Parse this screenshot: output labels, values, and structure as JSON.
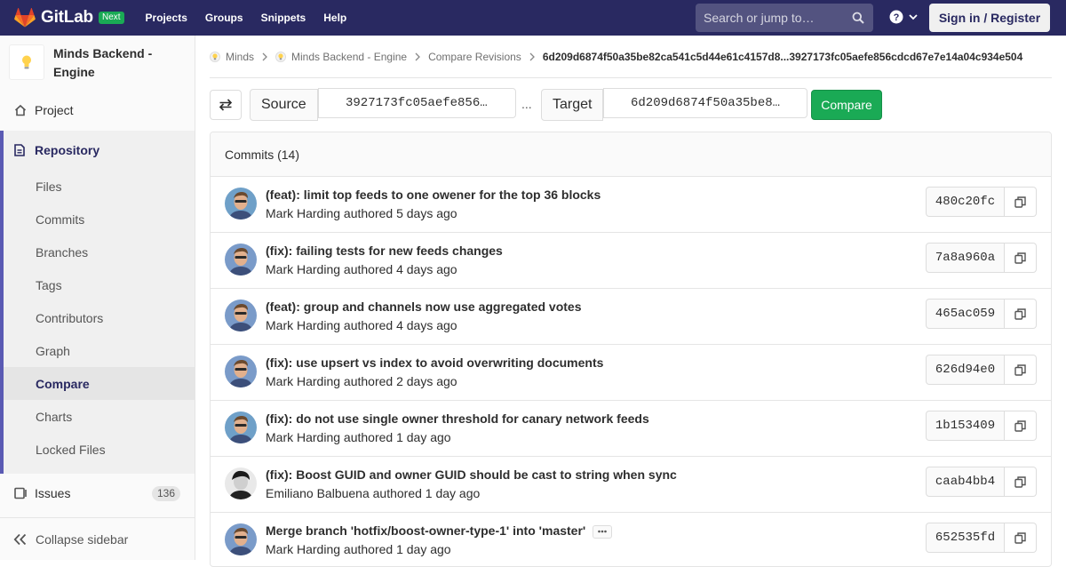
{
  "navbar": {
    "logo_text": "GitLab",
    "badge": "Next",
    "links": [
      "Projects",
      "Groups",
      "Snippets",
      "Help"
    ],
    "search_placeholder": "Search or jump to…",
    "signin_label": "Sign in / Register"
  },
  "sidebar": {
    "project_name": "Minds Backend - Engine",
    "project_label": "Project",
    "repository_label": "Repository",
    "repo_items": [
      "Files",
      "Commits",
      "Branches",
      "Tags",
      "Contributors",
      "Graph",
      "Compare",
      "Charts",
      "Locked Files"
    ],
    "active_item": "Compare",
    "issues_label": "Issues",
    "issues_count": "136",
    "collapse_label": "Collapse sidebar"
  },
  "breadcrumbs": {
    "items": [
      "Minds",
      "Minds Backend - Engine",
      "Compare Revisions"
    ],
    "current": "6d209d6874f50a35be82ca541c5d44e61c4157d8...3927173fc05aefe856cdcd67e7e14a04c934e504"
  },
  "compare": {
    "source_label": "Source",
    "source_value": "3927173fc05aefe856…",
    "separator": "...",
    "target_label": "Target",
    "target_value": "6d209d6874f50a35be8…",
    "compare_label": "Compare"
  },
  "commits": {
    "header": "Commits (14)",
    "rows": [
      {
        "title": "(feat): limit top feeds to one owener for the top 36 blocks",
        "author": "Mark Harding",
        "meta": "authored 5 days ago",
        "sha": "480c20fc",
        "avatar": "mark"
      },
      {
        "title": "(fix): failing tests for new feeds changes",
        "author": "Mark Harding",
        "meta": "authored 4 days ago",
        "sha": "7a8a960a",
        "avatar": "mark2"
      },
      {
        "title": "(feat): group and channels now use aggregated votes",
        "author": "Mark Harding",
        "meta": "authored 4 days ago",
        "sha": "465ac059",
        "avatar": "mark2"
      },
      {
        "title": "(fix): use upsert vs index to avoid overwriting documents",
        "author": "Mark Harding",
        "meta": "authored 2 days ago",
        "sha": "626d94e0",
        "avatar": "mark2"
      },
      {
        "title": "(fix): do not use single owner threshold for canary network feeds",
        "author": "Mark Harding",
        "meta": "authored 1 day ago",
        "sha": "1b153409",
        "avatar": "mark"
      },
      {
        "title": "(fix): Boost GUID and owner GUID should be cast to string when sync",
        "author": "Emiliano Balbuena",
        "meta": "authored 1 day ago",
        "sha": "caab4bb4",
        "avatar": "emiliano"
      },
      {
        "title": "Merge branch 'hotfix/boost-owner-type-1' into 'master'",
        "author": "Mark Harding",
        "meta": "authored 1 day ago",
        "sha": "652535fd",
        "avatar": "mark2",
        "has_more": true
      }
    ]
  },
  "colors": {
    "navbar": "#292961",
    "accent_green": "#1aaa55",
    "repo_border": "#5a5ab3"
  }
}
